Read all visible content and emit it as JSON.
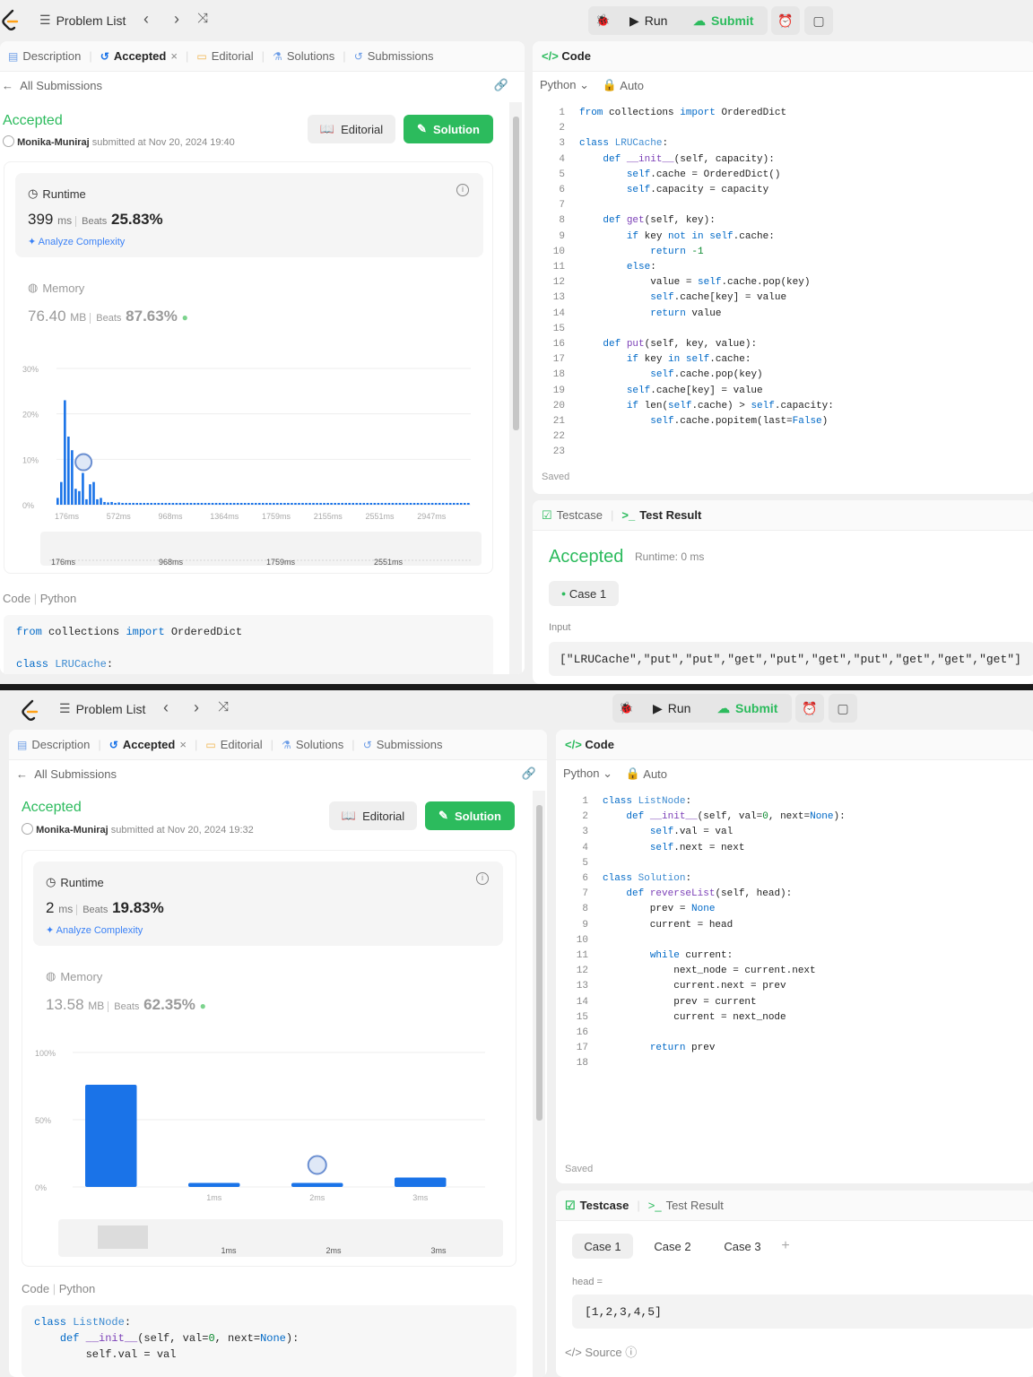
{
  "colors": {
    "accent": "#2cbb5d",
    "bar": "#1a73e8",
    "text": "#262626"
  },
  "s1": {
    "nav": {
      "problem_list": "Problem List",
      "run": "Run",
      "submit": "Submit"
    },
    "tabs": [
      {
        "label": "Description",
        "icon": "document-icon"
      },
      {
        "label": "Accepted",
        "icon": "history-icon"
      },
      {
        "label": "Editorial",
        "icon": "book-icon"
      },
      {
        "label": "Solutions",
        "icon": "flask-icon"
      },
      {
        "label": "Submissions",
        "icon": "history-icon"
      }
    ],
    "all_submissions": "All Submissions",
    "status": "Accepted",
    "author": "Monika-Muniraj",
    "submitted": "submitted at Nov 20, 2024 19:40",
    "editorial_btn": "Editorial",
    "solution_btn": "Solution",
    "runtime": {
      "label": "Runtime",
      "value": "399",
      "unit": "ms",
      "beats_label": "Beats",
      "beats": "25.83%",
      "analyze": "Analyze Complexity"
    },
    "memory": {
      "label": "Memory",
      "value": "76.40",
      "unit": "MB",
      "beats_label": "Beats",
      "beats": "87.63%"
    },
    "chart_data": {
      "type": "bar",
      "y_ticks": [
        "30%",
        "20%",
        "10%",
        "0%"
      ],
      "ylim": [
        0,
        30
      ],
      "x_ticks": [
        "176ms",
        "572ms",
        "968ms",
        "1364ms",
        "1759ms",
        "2155ms",
        "2551ms",
        "2947ms"
      ],
      "mini_ticks": [
        "176ms",
        "968ms",
        "1759ms",
        "2551ms"
      ],
      "values": [
        1.5,
        5,
        23,
        15,
        12,
        3.5,
        3,
        7,
        1.2,
        4.5,
        5,
        1.2,
        1.5,
        0.6,
        0.5,
        0.6,
        0.4,
        0.5,
        0.3,
        0.4,
        0.3,
        0.4,
        0.3,
        0.3,
        0.3,
        0.3,
        0.3,
        0.3,
        0.3,
        0.3,
        0.3,
        0.3,
        0.3,
        0.3,
        0.3,
        0.3,
        0.3,
        0.3,
        0.3,
        0.3,
        0.3,
        0.3,
        0.3,
        0.3,
        0.3,
        0.3,
        0.3,
        0.3,
        0.3,
        0.3,
        0.3,
        0.3,
        0.3,
        0.3,
        0.3,
        0.3,
        0.3,
        0.3,
        0.3,
        0.3,
        0.3,
        0.3,
        0.3,
        0.3,
        0.3,
        0.3,
        0.3,
        0.3,
        0.3,
        0.3,
        0.3,
        0.3,
        0.3,
        0.3,
        0.3,
        0.3,
        0.3,
        0.3,
        0.3,
        0.3,
        0.3,
        0.3,
        0.3,
        0.3,
        0.3,
        0.3,
        0.3,
        0.3,
        0.3,
        0.3,
        0.3,
        0.3,
        0.3,
        0.3,
        0.3,
        0.3,
        0.3,
        0.3,
        0.3,
        0.3,
        0.3,
        0.3,
        0.3,
        0.3,
        0.3,
        0.3,
        0.3,
        0.3,
        0.3,
        0.3,
        0.3,
        0.3,
        0.3,
        0.3,
        0.3
      ],
      "marker_index": 7
    },
    "code_label": "Code",
    "code_lang": "Python",
    "code_preview": [
      [
        {
          "t": "from",
          "c": "kw"
        },
        {
          "t": " collections ",
          "c": ""
        },
        {
          "t": "import",
          "c": "kw"
        },
        {
          "t": " OrderedDict",
          "c": ""
        }
      ],
      [],
      [
        {
          "t": "class",
          "c": "kw"
        },
        {
          "t": " LRUCache",
          "c": "cls"
        },
        {
          "t": ":",
          "c": ""
        }
      ]
    ],
    "editor": {
      "title": "Code",
      "lang": "Python",
      "mode": "Auto",
      "saved": "Saved",
      "lines": [
        [
          {
            "t": "from",
            "c": "kw"
          },
          {
            "t": " collections ",
            "c": ""
          },
          {
            "t": "import",
            "c": "kw"
          },
          {
            "t": " OrderedDict",
            "c": ""
          }
        ],
        [],
        [
          {
            "t": "class",
            "c": "kw"
          },
          {
            "t": " LRUCache",
            "c": "cls"
          },
          {
            "t": ":",
            "c": ""
          }
        ],
        [
          {
            "t": "    "
          },
          {
            "t": "def",
            "c": "kw"
          },
          {
            "t": " __init__",
            "c": "fn"
          },
          {
            "t": "(self, capacity):"
          }
        ],
        [
          {
            "t": "        "
          },
          {
            "t": "self",
            "c": "kw"
          },
          {
            "t": ".cache = OrderedDict()"
          }
        ],
        [
          {
            "t": "        "
          },
          {
            "t": "self",
            "c": "kw"
          },
          {
            "t": ".capacity = capacity"
          }
        ],
        [],
        [
          {
            "t": "    "
          },
          {
            "t": "def",
            "c": "kw"
          },
          {
            "t": " get",
            "c": "fn"
          },
          {
            "t": "(self, key):"
          }
        ],
        [
          {
            "t": "        "
          },
          {
            "t": "if",
            "c": "kw"
          },
          {
            "t": " key "
          },
          {
            "t": "not in",
            "c": "kw"
          },
          {
            "t": " "
          },
          {
            "t": "self",
            "c": "kw"
          },
          {
            "t": ".cache:"
          }
        ],
        [
          {
            "t": "            "
          },
          {
            "t": "return",
            "c": "kw"
          },
          {
            "t": " -1",
            "c": "num"
          }
        ],
        [
          {
            "t": "        "
          },
          {
            "t": "else",
            "c": "kw"
          },
          {
            "t": ":"
          }
        ],
        [
          {
            "t": "            value = "
          },
          {
            "t": "self",
            "c": "kw"
          },
          {
            "t": ".cache.pop(key)"
          }
        ],
        [
          {
            "t": "            "
          },
          {
            "t": "self",
            "c": "kw"
          },
          {
            "t": ".cache[key] = value"
          }
        ],
        [
          {
            "t": "            "
          },
          {
            "t": "return",
            "c": "kw"
          },
          {
            "t": " value"
          }
        ],
        [],
        [
          {
            "t": "    "
          },
          {
            "t": "def",
            "c": "kw"
          },
          {
            "t": " put",
            "c": "fn"
          },
          {
            "t": "(self, key, value):"
          }
        ],
        [
          {
            "t": "        "
          },
          {
            "t": "if",
            "c": "kw"
          },
          {
            "t": " key "
          },
          {
            "t": "in",
            "c": "kw"
          },
          {
            "t": " "
          },
          {
            "t": "self",
            "c": "kw"
          },
          {
            "t": ".cache:"
          }
        ],
        [
          {
            "t": "            "
          },
          {
            "t": "self",
            "c": "kw"
          },
          {
            "t": ".cache.pop(key)"
          }
        ],
        [
          {
            "t": "        "
          },
          {
            "t": "self",
            "c": "kw"
          },
          {
            "t": ".cache[key] = value"
          }
        ],
        [
          {
            "t": "        "
          },
          {
            "t": "if",
            "c": "kw"
          },
          {
            "t": " len("
          },
          {
            "t": "self",
            "c": "kw"
          },
          {
            "t": ".cache) > "
          },
          {
            "t": "self",
            "c": "kw"
          },
          {
            "t": ".capacity:"
          }
        ],
        [
          {
            "t": "            "
          },
          {
            "t": "self",
            "c": "kw"
          },
          {
            "t": ".cache.popitem(last="
          },
          {
            "t": "False",
            "c": "kw"
          },
          {
            "t": ")"
          }
        ],
        [],
        []
      ]
    },
    "bottom": {
      "testcase": "Testcase",
      "test_result": "Test Result",
      "result": "Accepted",
      "runtime": "Runtime: 0 ms",
      "case": "Case 1",
      "input_label": "Input",
      "input_value": "[\"LRUCache\",\"put\",\"put\",\"get\",\"put\",\"get\",\"put\",\"get\",\"get\",\"get\"]"
    }
  },
  "s2": {
    "nav": {
      "problem_list": "Problem List",
      "run": "Run",
      "submit": "Submit"
    },
    "tabs": [
      {
        "label": "Description",
        "icon": "document-icon"
      },
      {
        "label": "Accepted",
        "icon": "history-icon"
      },
      {
        "label": "Editorial",
        "icon": "book-icon"
      },
      {
        "label": "Solutions",
        "icon": "flask-icon"
      },
      {
        "label": "Submissions",
        "icon": "history-icon"
      }
    ],
    "all_submissions": "All Submissions",
    "status": "Accepted",
    "author": "Monika-Muniraj",
    "submitted": "submitted at Nov 20, 2024 19:32",
    "editorial_btn": "Editorial",
    "solution_btn": "Solution",
    "runtime": {
      "label": "Runtime",
      "value": "2",
      "unit": "ms",
      "beats_label": "Beats",
      "beats": "19.83%",
      "analyze": "Analyze Complexity"
    },
    "memory": {
      "label": "Memory",
      "value": "13.58",
      "unit": "MB",
      "beats_label": "Beats",
      "beats": "62.35%"
    },
    "chart_data": {
      "type": "bar",
      "y_ticks": [
        "100%",
        "50%",
        "0%"
      ],
      "ylim": [
        0,
        100
      ],
      "categories": [
        "",
        "1ms",
        "2ms",
        "3ms"
      ],
      "x_ticks": [
        "1ms",
        "2ms",
        "3ms"
      ],
      "mini_ticks": [
        "1ms",
        "2ms",
        "3ms"
      ],
      "values": [
        76,
        3,
        3,
        7
      ],
      "marker_index": 2
    },
    "code_label": "Code",
    "code_lang": "Python",
    "code_preview": [
      [
        {
          "t": "class",
          "c": "kw"
        },
        {
          "t": " ListNode",
          "c": "cls"
        },
        {
          "t": ":",
          "c": ""
        }
      ],
      [
        {
          "t": "    "
        },
        {
          "t": "def",
          "c": "kw"
        },
        {
          "t": " __init__",
          "c": "fn"
        },
        {
          "t": "(self, val="
        },
        {
          "t": "0",
          "c": "num"
        },
        {
          "t": ", next="
        },
        {
          "t": "None",
          "c": "kw"
        },
        {
          "t": "):"
        }
      ],
      [
        {
          "t": "        self.val = val"
        }
      ]
    ],
    "editor": {
      "title": "Code",
      "lang": "Python",
      "mode": "Auto",
      "saved": "Saved",
      "lines": [
        [
          {
            "t": "class",
            "c": "kw"
          },
          {
            "t": " ListNode",
            "c": "cls"
          },
          {
            "t": ":"
          }
        ],
        [
          {
            "t": "    "
          },
          {
            "t": "def",
            "c": "kw"
          },
          {
            "t": " __init__",
            "c": "fn"
          },
          {
            "t": "(self, val="
          },
          {
            "t": "0",
            "c": "num"
          },
          {
            "t": ", next="
          },
          {
            "t": "None",
            "c": "kw"
          },
          {
            "t": "):"
          }
        ],
        [
          {
            "t": "        "
          },
          {
            "t": "self",
            "c": "kw"
          },
          {
            "t": ".val = val"
          }
        ],
        [
          {
            "t": "        "
          },
          {
            "t": "self",
            "c": "kw"
          },
          {
            "t": ".next = next"
          }
        ],
        [],
        [
          {
            "t": "class",
            "c": "kw"
          },
          {
            "t": " Solution",
            "c": "cls"
          },
          {
            "t": ":"
          }
        ],
        [
          {
            "t": "    "
          },
          {
            "t": "def",
            "c": "kw"
          },
          {
            "t": " reverseList",
            "c": "fn"
          },
          {
            "t": "(self, head):"
          }
        ],
        [
          {
            "t": "        prev = "
          },
          {
            "t": "None",
            "c": "kw"
          }
        ],
        [
          {
            "t": "        current = head"
          }
        ],
        [],
        [
          {
            "t": "        "
          },
          {
            "t": "while",
            "c": "kw"
          },
          {
            "t": " current:"
          }
        ],
        [
          {
            "t": "            next_node = current.next"
          }
        ],
        [
          {
            "t": "            current.next = prev"
          }
        ],
        [
          {
            "t": "            prev = current"
          }
        ],
        [
          {
            "t": "            current = next_node"
          }
        ],
        [],
        [
          {
            "t": "        "
          },
          {
            "t": "return",
            "c": "kw"
          },
          {
            "t": " prev"
          }
        ],
        []
      ]
    },
    "bottom": {
      "testcase": "Testcase",
      "test_result": "Test Result",
      "cases": [
        "Case 1",
        "Case 2",
        "Case 3"
      ],
      "add": "+",
      "input_label": "head =",
      "input_value": "[1,2,3,4,5]",
      "source": "Source"
    }
  }
}
